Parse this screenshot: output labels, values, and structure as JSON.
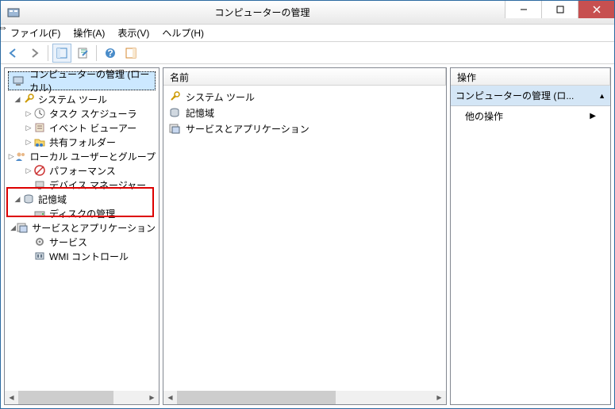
{
  "title": "コンピューターの管理",
  "menus": {
    "file": "ファイル(F)",
    "action": "操作(A)",
    "view": "表示(V)",
    "help": "ヘルプ(H)"
  },
  "tree": {
    "root": "コンピューターの管理 (ローカル)",
    "n1": "システム ツール",
    "n1_1": "タスク スケジューラ",
    "n1_2": "イベント ビューアー",
    "n1_3": "共有フォルダー",
    "n1_4": "ローカル ユーザーとグループ",
    "n1_5": "パフォーマンス",
    "n1_6": "デバイス マネージャー",
    "n2": "記憶域",
    "n2_1": "ディスクの管理",
    "n3": "サービスとアプリケーション",
    "n3_1": "サービス",
    "n3_2": "WMI コントロール"
  },
  "mid": {
    "header": "名前",
    "item1": "システム ツール",
    "item2": "記憶域",
    "item3": "サービスとアプリケーション"
  },
  "right": {
    "header": "操作",
    "section": "コンピューターの管理 (ロ...",
    "other_ops": "他の操作"
  }
}
